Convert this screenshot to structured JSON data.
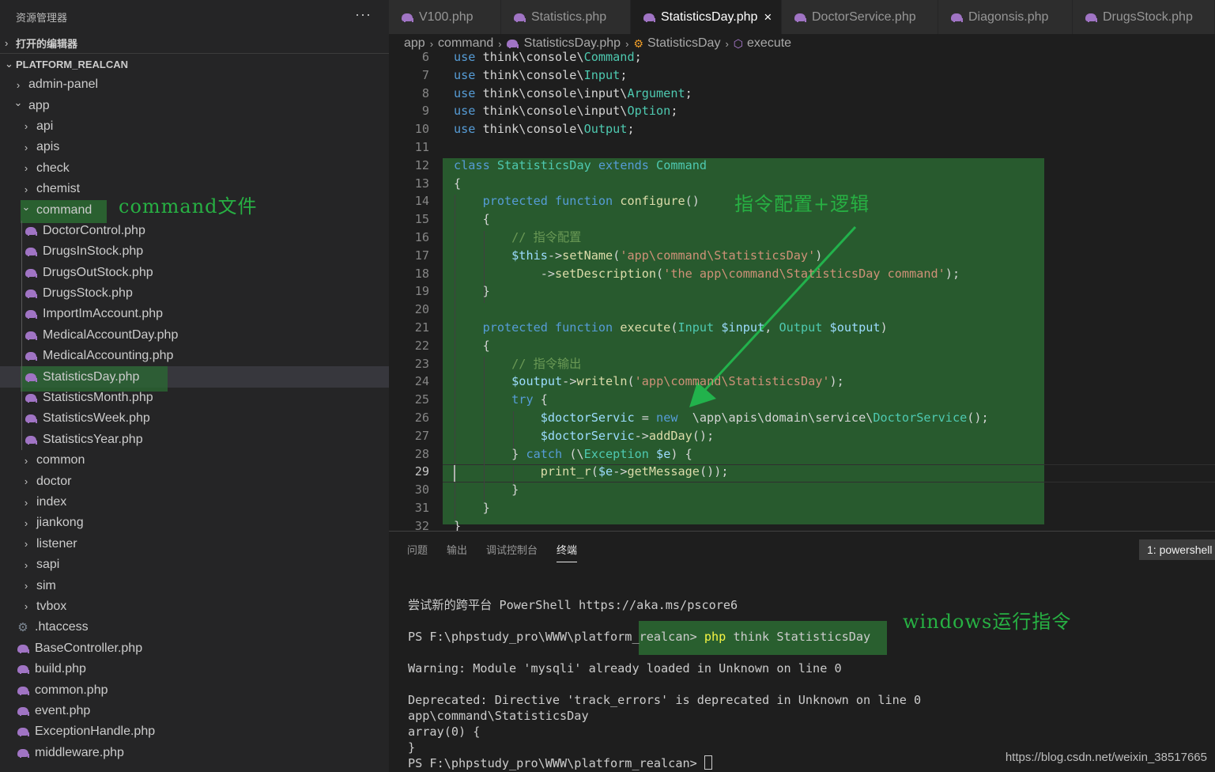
{
  "explorer": {
    "title": "资源管理器",
    "more": "···",
    "open_editors": "打开的编辑器",
    "workspace": "PLATFORM_REALCAN",
    "items": [
      {
        "label": "admin-panel",
        "type": "folder",
        "level": 0,
        "expanded": false
      },
      {
        "label": "app",
        "type": "folder",
        "level": 0,
        "expanded": true
      },
      {
        "label": "api",
        "type": "folder",
        "level": 1,
        "expanded": false
      },
      {
        "label": "apis",
        "type": "folder",
        "level": 1,
        "expanded": false
      },
      {
        "label": "check",
        "type": "folder",
        "level": 1,
        "expanded": false
      },
      {
        "label": "chemist",
        "type": "folder",
        "level": 1,
        "expanded": false
      },
      {
        "label": "command",
        "type": "folder",
        "level": 1,
        "expanded": true
      },
      {
        "label": "DoctorControl.php",
        "type": "php",
        "level": 2
      },
      {
        "label": "DrugsInStock.php",
        "type": "php",
        "level": 2
      },
      {
        "label": "DrugsOutStock.php",
        "type": "php",
        "level": 2
      },
      {
        "label": "DrugsStock.php",
        "type": "php",
        "level": 2
      },
      {
        "label": "ImportImAccount.php",
        "type": "php",
        "level": 2
      },
      {
        "label": "MedicalAccountDay.php",
        "type": "php",
        "level": 2
      },
      {
        "label": "MedicalAccounting.php",
        "type": "php",
        "level": 2
      },
      {
        "label": "StatisticsDay.php",
        "type": "php",
        "level": 2,
        "selected": true
      },
      {
        "label": "StatisticsMonth.php",
        "type": "php",
        "level": 2
      },
      {
        "label": "StatisticsWeek.php",
        "type": "php",
        "level": 2
      },
      {
        "label": "StatisticsYear.php",
        "type": "php",
        "level": 2
      },
      {
        "label": "common",
        "type": "folder",
        "level": 1,
        "expanded": false
      },
      {
        "label": "doctor",
        "type": "folder",
        "level": 1,
        "expanded": false
      },
      {
        "label": "index",
        "type": "folder",
        "level": 1,
        "expanded": false
      },
      {
        "label": "jiankong",
        "type": "folder",
        "level": 1,
        "expanded": false
      },
      {
        "label": "listener",
        "type": "folder",
        "level": 1,
        "expanded": false
      },
      {
        "label": "sapi",
        "type": "folder",
        "level": 1,
        "expanded": false
      },
      {
        "label": "sim",
        "type": "folder",
        "level": 1,
        "expanded": false
      },
      {
        "label": "tvbox",
        "type": "folder",
        "level": 1,
        "expanded": false
      },
      {
        "label": ".htaccess",
        "type": "gear",
        "level": 1
      },
      {
        "label": "BaseController.php",
        "type": "php",
        "level": 1
      },
      {
        "label": "build.php",
        "type": "php",
        "level": 1
      },
      {
        "label": "common.php",
        "type": "php",
        "level": 1
      },
      {
        "label": "event.php",
        "type": "php",
        "level": 1
      },
      {
        "label": "ExceptionHandle.php",
        "type": "php",
        "level": 1
      },
      {
        "label": "middleware.php",
        "type": "php",
        "level": 1
      }
    ]
  },
  "annotations": {
    "command_files": "command文件",
    "config_logic": "指令配置+逻辑",
    "windows_run": "windows运行指令"
  },
  "tabs": [
    {
      "label": "V100.php",
      "active": false
    },
    {
      "label": "Statistics.php",
      "active": false
    },
    {
      "label": "StatisticsDay.php",
      "active": true
    },
    {
      "label": "DoctorService.php",
      "active": false
    },
    {
      "label": "Diagonsis.php",
      "active": false
    },
    {
      "label": "DrugsStock.php",
      "active": false
    }
  ],
  "close_glyph": "×",
  "breadcrumb": {
    "app": "app",
    "command": "command",
    "file": "StatisticsDay.php",
    "class": "StatisticsDay",
    "method": "execute"
  },
  "code": {
    "current_line": 29,
    "lines": [
      {
        "n": 6,
        "tokens": [
          [
            "k",
            "use "
          ],
          [
            "p",
            "think\\console\\"
          ],
          [
            "t",
            "Command"
          ],
          [
            "p",
            ";"
          ]
        ]
      },
      {
        "n": 7,
        "tokens": [
          [
            "k",
            "use "
          ],
          [
            "p",
            "think\\console\\"
          ],
          [
            "t",
            "Input"
          ],
          [
            "p",
            ";"
          ]
        ]
      },
      {
        "n": 8,
        "tokens": [
          [
            "k",
            "use "
          ],
          [
            "p",
            "think\\console\\input\\"
          ],
          [
            "t",
            "Argument"
          ],
          [
            "p",
            ";"
          ]
        ]
      },
      {
        "n": 9,
        "tokens": [
          [
            "k",
            "use "
          ],
          [
            "p",
            "think\\console\\input\\"
          ],
          [
            "t",
            "Option"
          ],
          [
            "p",
            ";"
          ]
        ]
      },
      {
        "n": 10,
        "tokens": [
          [
            "k",
            "use "
          ],
          [
            "p",
            "think\\console\\"
          ],
          [
            "t",
            "Output"
          ],
          [
            "p",
            ";"
          ]
        ]
      },
      {
        "n": 11,
        "tokens": []
      },
      {
        "n": 12,
        "tokens": [
          [
            "k",
            "class "
          ],
          [
            "t",
            "StatisticsDay "
          ],
          [
            "k",
            "extends "
          ],
          [
            "t",
            "Command"
          ]
        ]
      },
      {
        "n": 13,
        "tokens": [
          [
            "p",
            "{"
          ]
        ]
      },
      {
        "n": 14,
        "tokens": [
          [
            "p",
            "    "
          ],
          [
            "k",
            "protected "
          ],
          [
            "k",
            "function "
          ],
          [
            "f",
            "configure"
          ],
          [
            "p",
            "()"
          ]
        ]
      },
      {
        "n": 15,
        "tokens": [
          [
            "p",
            "    {"
          ]
        ]
      },
      {
        "n": 16,
        "tokens": [
          [
            "p",
            "        "
          ],
          [
            "c",
            "// 指令配置"
          ]
        ]
      },
      {
        "n": 17,
        "tokens": [
          [
            "p",
            "        "
          ],
          [
            "v",
            "$this"
          ],
          [
            "p",
            "->"
          ],
          [
            "f",
            "setName"
          ],
          [
            "p",
            "("
          ],
          [
            "s",
            "'app\\command\\StatisticsDay'"
          ],
          [
            "p",
            ")"
          ]
        ]
      },
      {
        "n": 18,
        "tokens": [
          [
            "p",
            "            ->"
          ],
          [
            "f",
            "setDescription"
          ],
          [
            "p",
            "("
          ],
          [
            "s",
            "'the app\\command\\StatisticsDay command'"
          ],
          [
            "p",
            ");"
          ]
        ]
      },
      {
        "n": 19,
        "tokens": [
          [
            "p",
            "    }"
          ]
        ]
      },
      {
        "n": 20,
        "tokens": []
      },
      {
        "n": 21,
        "tokens": [
          [
            "p",
            "    "
          ],
          [
            "k",
            "protected "
          ],
          [
            "k",
            "function "
          ],
          [
            "f",
            "execute"
          ],
          [
            "p",
            "("
          ],
          [
            "t",
            "Input "
          ],
          [
            "v",
            "$input"
          ],
          [
            "p",
            ", "
          ],
          [
            "t",
            "Output "
          ],
          [
            "v",
            "$output"
          ],
          [
            "p",
            ")"
          ]
        ]
      },
      {
        "n": 22,
        "tokens": [
          [
            "p",
            "    {"
          ]
        ]
      },
      {
        "n": 23,
        "tokens": [
          [
            "p",
            "        "
          ],
          [
            "c",
            "// 指令输出"
          ]
        ]
      },
      {
        "n": 24,
        "tokens": [
          [
            "p",
            "        "
          ],
          [
            "v",
            "$output"
          ],
          [
            "p",
            "->"
          ],
          [
            "f",
            "writeln"
          ],
          [
            "p",
            "("
          ],
          [
            "s",
            "'app\\command\\StatisticsDay'"
          ],
          [
            "p",
            ");"
          ]
        ]
      },
      {
        "n": 25,
        "tokens": [
          [
            "p",
            "        "
          ],
          [
            "k",
            "try "
          ],
          [
            "p",
            "{"
          ]
        ]
      },
      {
        "n": 26,
        "tokens": [
          [
            "p",
            "            "
          ],
          [
            "v",
            "$doctorServic "
          ],
          [
            "p",
            "= "
          ],
          [
            "k",
            "new  "
          ],
          [
            "p",
            "\\app\\apis\\domain\\service\\"
          ],
          [
            "t",
            "DoctorService"
          ],
          [
            "p",
            "();"
          ]
        ]
      },
      {
        "n": 27,
        "tokens": [
          [
            "p",
            "            "
          ],
          [
            "v",
            "$doctorServic"
          ],
          [
            "p",
            "->"
          ],
          [
            "f",
            "addDay"
          ],
          [
            "p",
            "();"
          ]
        ]
      },
      {
        "n": 28,
        "tokens": [
          [
            "p",
            "        } "
          ],
          [
            "k",
            "catch "
          ],
          [
            "p",
            "(\\"
          ],
          [
            "t",
            "Exception "
          ],
          [
            "v",
            "$e"
          ],
          [
            "p",
            ") {"
          ]
        ]
      },
      {
        "n": 29,
        "tokens": [
          [
            "p",
            "            "
          ],
          [
            "f",
            "print_r"
          ],
          [
            "p",
            "("
          ],
          [
            "v",
            "$e"
          ],
          [
            "p",
            "->"
          ],
          [
            "f",
            "getMessage"
          ],
          [
            "p",
            "());"
          ]
        ]
      },
      {
        "n": 30,
        "tokens": [
          [
            "p",
            "        }"
          ]
        ]
      },
      {
        "n": 31,
        "tokens": [
          [
            "p",
            "    }"
          ]
        ]
      },
      {
        "n": 32,
        "tokens": [
          [
            "p",
            "}"
          ]
        ]
      }
    ]
  },
  "panel": {
    "tabs": [
      {
        "label": "问题",
        "active": false
      },
      {
        "label": "输出",
        "active": false
      },
      {
        "label": "调试控制台",
        "active": false
      },
      {
        "label": "终端",
        "active": true
      }
    ],
    "terminal_select": "1: powershell",
    "terminal": {
      "l1": "尝试新的跨平台 PowerShell https://aka.ms/pscore6",
      "prompt": "PS F:\\phpstudy_pro\\WWW\\platform_realcan> ",
      "cmd_php": "php",
      "cmd_rest": " think StatisticsDay",
      "l3": "Warning: Module 'mysqli' already loaded in Unknown on line 0",
      "l4": "Deprecated: Directive 'track_errors' is deprecated in Unknown on line 0",
      "l5": "app\\command\\StatisticsDay",
      "l6": "array(0) {",
      "l7": "}",
      "l8": "PS F:\\phpstudy_pro\\WWW\\platform_realcan> "
    }
  },
  "watermark": "https://blog.csdn.net/weixin_38517665",
  "colors": {
    "highlight_green": "#2b6b33",
    "annotation_green": "#27b043",
    "arrow_green": "#22b24c"
  }
}
